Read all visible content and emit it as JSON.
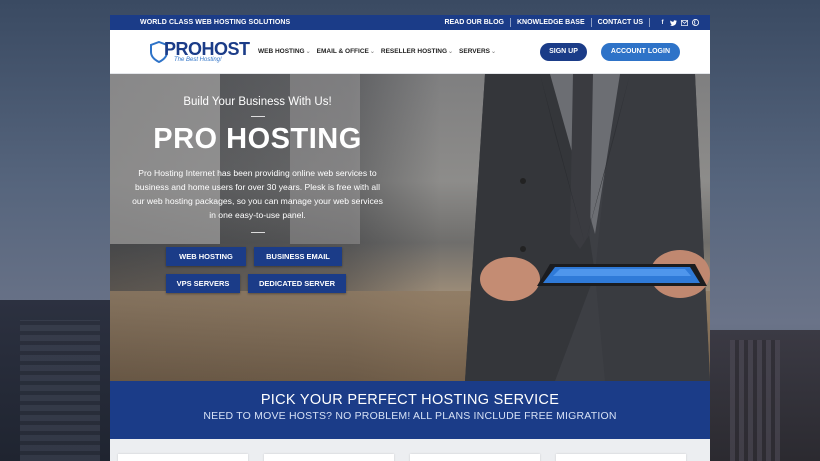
{
  "topbar": {
    "tagline": "WORLD CLASS WEB HOSTING SOLUTIONS",
    "links": [
      "READ OUR BLOG",
      "KNOWLEDGE BASE",
      "CONTACT US"
    ],
    "social": [
      "facebook-icon",
      "twitter-icon",
      "email-icon",
      "pinterest-icon"
    ]
  },
  "logo": {
    "name": "PROHOST",
    "tagline": "The Best Hosting!"
  },
  "nav": [
    {
      "label": "WEB HOSTING"
    },
    {
      "label": "EMAIL & OFFICE"
    },
    {
      "label": "RESELLER HOSTING"
    },
    {
      "label": "SERVERS"
    }
  ],
  "header": {
    "signup": "SIGN UP",
    "login": "ACCOUNT LOGIN"
  },
  "hero": {
    "kicker": "Build Your Business With Us!",
    "title": "PRO HOSTING",
    "description": "Pro Hosting Internet has been providing online web services to business and home users for over 30 years. Plesk is free with all our web hosting packages, so you can manage your web services in one easy-to-use panel.",
    "buttons": [
      "WEB HOSTING",
      "BUSINESS EMAIL",
      "VPS SERVERS",
      "DEDICATED SERVER"
    ]
  },
  "pick": {
    "title": "PICK YOUR PERFECT HOSTING SERVICE",
    "subtitle": "NEED TO MOVE HOSTS? NO PROBLEM! ALL PLANS INCLUDE FREE MIGRATION"
  },
  "colors": {
    "primary": "#1b3c88",
    "accent": "#2e73c8"
  }
}
